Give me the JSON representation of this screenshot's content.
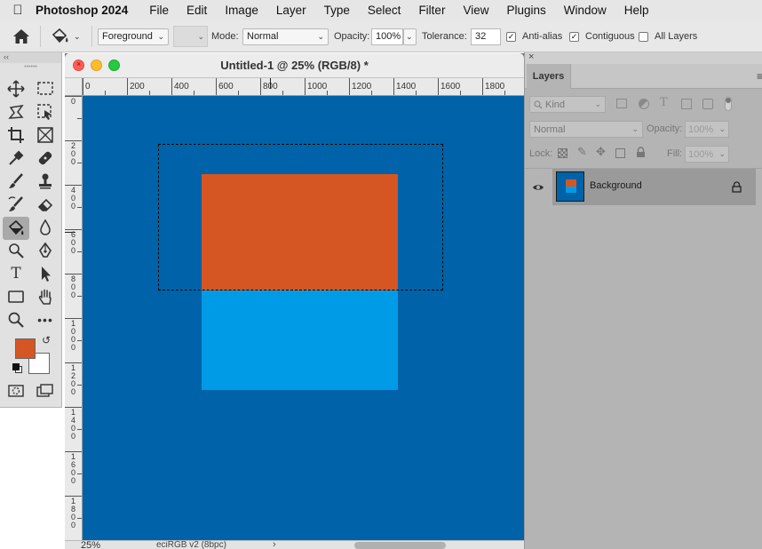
{
  "menubar": {
    "app_name": "Photoshop 2024",
    "items": [
      "File",
      "Edit",
      "Image",
      "Layer",
      "Type",
      "Select",
      "Filter",
      "View",
      "Plugins",
      "Window",
      "Help"
    ]
  },
  "options": {
    "fill_source": "Foreground",
    "mode_label": "Mode:",
    "mode_value": "Normal",
    "opacity_label": "Opacity:",
    "opacity_value": "100%",
    "tolerance_label": "Tolerance:",
    "tolerance_value": "32",
    "antialias_label": "Anti-alias",
    "antialias_checked": true,
    "contiguous_label": "Contiguous",
    "contiguous_checked": true,
    "all_layers_label": "All Layers",
    "all_layers_checked": false
  },
  "tools": {
    "active_tool": "paint-bucket",
    "foreground_color": "#d55622",
    "background_color": "#ffffff"
  },
  "document": {
    "title": "Untitled-1 @ 25% (RGB/8) *",
    "ruler_h_labels": [
      "0",
      "200",
      "400",
      "600",
      "800",
      "1000",
      "1200",
      "1400",
      "1600",
      "1800"
    ],
    "ruler_v_labels": [
      "0",
      "200",
      "400",
      "600",
      "800",
      "1000",
      "1200",
      "1400",
      "1600",
      "1800"
    ],
    "zoom": "25%",
    "color_profile": "eciRGB v2 (8bpc)",
    "canvas_color": "#0062a8",
    "rect_orange_color": "#d55622",
    "rect_cyan_color": "#009be6"
  },
  "layers_panel": {
    "tab_label": "Layers",
    "filter_kind": "Kind",
    "blend_mode": "Normal",
    "opacity_label": "Opacity:",
    "opacity_value": "100%",
    "lock_label": "Lock:",
    "fill_label": "Fill:",
    "fill_value": "100%",
    "layers": [
      {
        "name": "Background",
        "visible": true,
        "locked": true
      }
    ]
  }
}
